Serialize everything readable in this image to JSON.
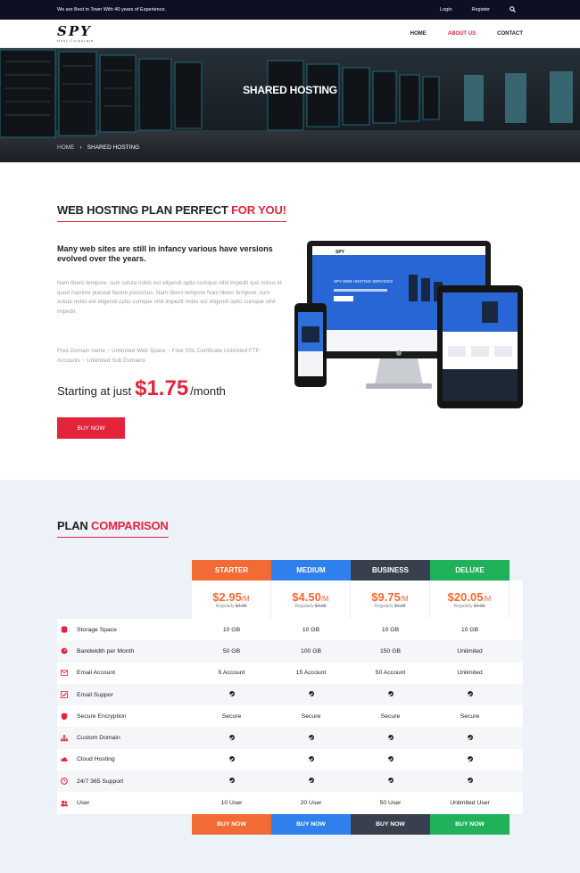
{
  "topbar": {
    "tagline": "We are Best in Town With 40 years of Experience.",
    "login": "Login",
    "register": "Register",
    "search_icon": "search-icon"
  },
  "header": {
    "logo_mark": "SPY",
    "logo_tag": "Host Corporate",
    "nav": [
      "HOME",
      "ABOUT US",
      "CONTACT"
    ],
    "active_nav": "ABOUT US"
  },
  "hero": {
    "title": "SHARED HOSTING",
    "breadcrumb_home": "HOME",
    "breadcrumb_sep": "›",
    "breadcrumb_current": "SHARED HOSTING"
  },
  "intro": {
    "title_main": "WEB HOSTING PLAN PERFECT ",
    "title_accent": "FOR YOU!",
    "lead": "Many web sites are still in infancy various have versions evolved over the years.",
    "paragraph": "Nam libero tempore, cum soluta nobis est eligendi optio cumque nihil impedit quo minus id quod maxime placeat facere possimus. Nam libero tempore Nam libero tempore, cum soluta nobis est eligendi optio cumque nihil impedit nobis est eligendi optio cumque nihil impedit",
    "features": "Free Domain name ~ Unlimited Web Space ~ Free SSL Certificate Unlimited FTP Accounts ~ Unlimited Sub Domains",
    "price_prefix": "Starting at just",
    "price_amount": "$1.75",
    "price_suffix": "/month",
    "button": "BUY NOW",
    "screen_logo": "SPY",
    "screen_headline": "SPY WEB HOSTING SERVICES"
  },
  "comparison": {
    "title_main": "PLAN ",
    "title_accent": "COMPARISON",
    "plans": [
      {
        "name": "STARTER",
        "price": "$2.95",
        "per": "/M",
        "regular": "Regularly",
        "old": "$4.99",
        "color": "#f26a34"
      },
      {
        "name": "MEDIUM",
        "price": "$4.50",
        "per": "/M",
        "regular": "Regularly",
        "old": "$4.99",
        "color": "#2f80ed"
      },
      {
        "name": "BUSINESS",
        "price": "$9.75",
        "per": "/M",
        "regular": "Regularly",
        "old": "$4.99",
        "color": "#3a3f4e"
      },
      {
        "name": "DELUXE",
        "price": "$20.05",
        "per": "/M",
        "regular": "Regularly",
        "old": "$4.99",
        "color": "#1fb25a"
      }
    ],
    "features": [
      {
        "label": "Storage Space",
        "icon": "database-icon",
        "values": [
          "10 GB",
          "10 GB",
          "10 GB",
          "10 GB"
        ]
      },
      {
        "label": "Bandwidth per Month",
        "icon": "gauge-icon",
        "values": [
          "50 GB",
          "100 GB",
          "150 GB",
          "Unlimited"
        ]
      },
      {
        "label": "Email Account",
        "icon": "envelope-icon",
        "values": [
          "5 Account",
          "15 Account",
          "50 Account",
          "Unlimited"
        ]
      },
      {
        "label": "Email Suppor",
        "icon": "check-square-icon",
        "values": [
          "check",
          "check",
          "check",
          "check"
        ]
      },
      {
        "label": "Secure Encryption",
        "icon": "shield-icon",
        "values": [
          "Secure",
          "Secure",
          "Secure",
          "Secure"
        ]
      },
      {
        "label": "Custom Domain",
        "icon": "sitemap-icon",
        "values": [
          "check",
          "check",
          "check",
          "check"
        ]
      },
      {
        "label": "Cloud Hosting",
        "icon": "cloud-icon",
        "values": [
          "check",
          "check",
          "check",
          "check"
        ]
      },
      {
        "label": "24/7 365 Support",
        "icon": "clock-icon",
        "values": [
          "check",
          "check",
          "check",
          "check"
        ]
      },
      {
        "label": "User",
        "icon": "users-icon",
        "values": [
          "10 User",
          "20 User",
          "50 User",
          "Unlimited User"
        ]
      }
    ],
    "buy_label": "BUY NOW"
  }
}
